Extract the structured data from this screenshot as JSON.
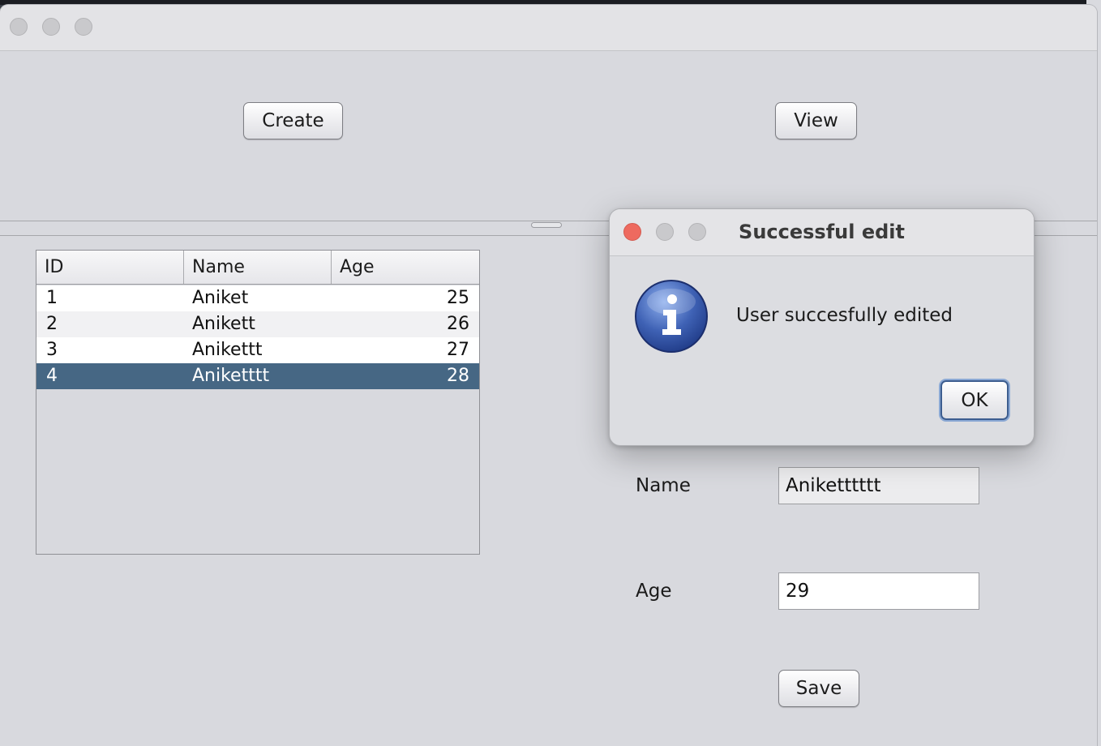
{
  "toolbar": {
    "create_label": "Create",
    "view_label": "View"
  },
  "table": {
    "columns": [
      "ID",
      "Name",
      "Age"
    ],
    "rows": [
      {
        "id": "1",
        "name": "Aniket",
        "age": "25"
      },
      {
        "id": "2",
        "name": "Anikett",
        "age": "26"
      },
      {
        "id": "3",
        "name": "Anikettt",
        "age": "27"
      },
      {
        "id": "4",
        "name": "Aniketttt",
        "age": "28"
      }
    ],
    "selected_row": 4
  },
  "form": {
    "name_label": "Name",
    "name_value": "Aniketttttt",
    "age_label": "Age",
    "age_value": "29",
    "save_label": "Save"
  },
  "dialog": {
    "title": "Successful edit",
    "message": "User succesfully edited",
    "ok_label": "OK",
    "icon": "info-icon"
  },
  "colors": {
    "selected_row": "#466784",
    "close_button": "#ee6a5f",
    "info_icon": "#3f62b5"
  }
}
